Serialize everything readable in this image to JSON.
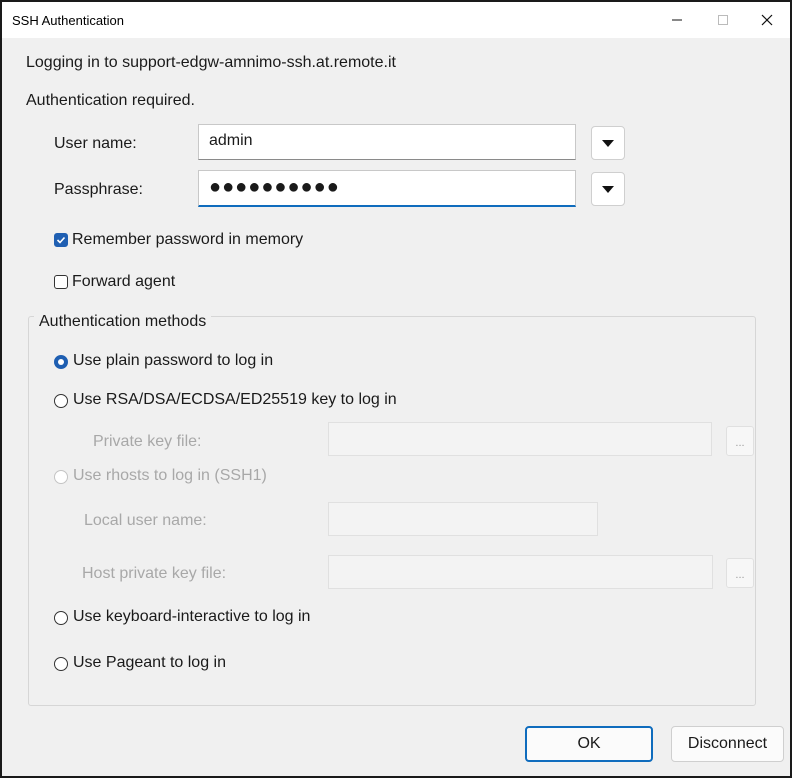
{
  "window": {
    "title": "SSH Authentication"
  },
  "header": {
    "logging_in": "Logging in to support-edgw-amnimo-ssh.at.remote.it",
    "auth_required": "Authentication required."
  },
  "form": {
    "username_label": "User name:",
    "username_value": "admin",
    "passphrase_label": "Passphrase:",
    "passphrase_masked": "●●●●●●●●●●",
    "remember_label": "Remember password in memory",
    "remember_checked": true,
    "forward_label": "Forward agent",
    "forward_checked": false
  },
  "methods": {
    "legend": "Authentication methods",
    "plain_password": "Use plain password to log in",
    "rsa_key": "Use RSA/DSA/ECDSA/ED25519 key to log in",
    "private_key_label": "Private key file:",
    "browse": "...",
    "rhosts": "Use rhosts to log in (SSH1)",
    "local_user_label": "Local user name:",
    "host_key_label": "Host private key file:",
    "keyboard_interactive": "Use keyboard-interactive to log in",
    "pageant": "Use Pageant to log in",
    "selected": "plain_password"
  },
  "buttons": {
    "ok": "OK",
    "disconnect": "Disconnect"
  }
}
